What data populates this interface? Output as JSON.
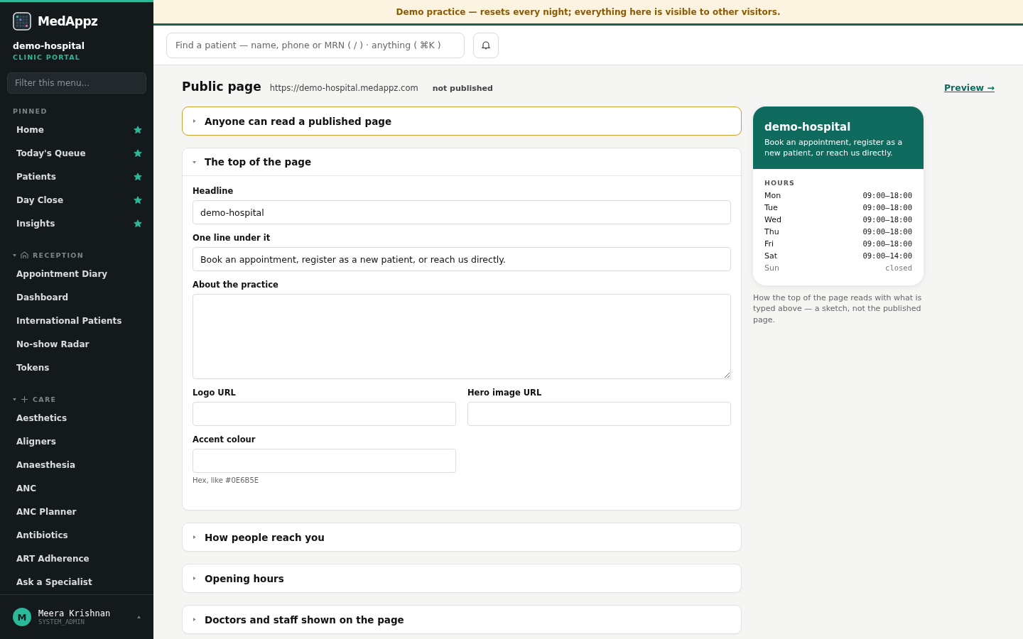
{
  "brand": {
    "name": "MedAppz",
    "org": "demo-hospital",
    "portal": "CLINIC PORTAL"
  },
  "sidebar": {
    "filter_placeholder": "Filter this menu...",
    "pinned": {
      "title": "PINNED",
      "items": [
        {
          "label": "Home",
          "starred": true
        },
        {
          "label": "Today's Queue",
          "starred": true
        },
        {
          "label": "Patients",
          "starred": true
        },
        {
          "label": "Day Close",
          "starred": true
        },
        {
          "label": "Insights",
          "starred": true
        }
      ]
    },
    "groups": [
      {
        "title": "RECEPTION",
        "expanded": true,
        "items": [
          "Appointment Diary",
          "Dashboard",
          "International Patients",
          "No-show Radar",
          "Tokens"
        ]
      },
      {
        "title": "CARE",
        "expanded": true,
        "items": [
          "Aesthetics",
          "Aligners",
          "Anaesthesia",
          "ANC",
          "ANC Planner",
          "Antibiotics",
          "ART Adherence",
          "Ask a Specialist"
        ]
      }
    ],
    "user": {
      "initial": "M",
      "name": "Meera Krishnan",
      "role": "SYSTEM_ADMIN"
    }
  },
  "banner": "Demo practice — resets every night; everything here is visible to other visitors.",
  "search": {
    "placeholder": "Find a patient — name, phone or MRN ( / ) · anything ( ⌘K )"
  },
  "page": {
    "title": "Public page",
    "url": "https://demo-hospital.medappz.com",
    "status": "not published",
    "preview_link": "Preview →"
  },
  "sections": [
    {
      "title": "Anyone can read a published page",
      "expanded": false,
      "selected": true
    },
    {
      "title": "The top of the page",
      "expanded": true,
      "selected": false,
      "fields": [
        {
          "kind": "text",
          "label": "Headline",
          "value": "demo-hospital"
        },
        {
          "kind": "text",
          "label": "One line under it",
          "value": "Book an appointment, register as a new patient, or reach us directly."
        },
        {
          "kind": "textarea",
          "label": "About the practice"
        },
        {
          "kind": "short",
          "label": "Logo URL"
        },
        {
          "kind": "short",
          "label": "Hero image URL"
        },
        {
          "kind": "short",
          "label": "Accent colour",
          "hint": "Hex, like #0E6B5E"
        }
      ]
    },
    {
      "title": "How people reach you",
      "expanded": false,
      "selected": false
    },
    {
      "title": "Opening hours",
      "expanded": false,
      "selected": false
    },
    {
      "title": "Doctors and staff shown on the page",
      "expanded": false,
      "selected": false
    }
  ],
  "preview": {
    "title": "demo-hospital",
    "subtitle": "Book an appointment, register as a new patient, or reach us directly.",
    "hours_title": "HOURS",
    "hours": [
      {
        "day": "Mon",
        "time": "09:00–18:00",
        "closed": false
      },
      {
        "day": "Tue",
        "time": "09:00–18:00",
        "closed": false
      },
      {
        "day": "Wed",
        "time": "09:00–18:00",
        "closed": false
      },
      {
        "day": "Thu",
        "time": "09:00–18:00",
        "closed": false
      },
      {
        "day": "Fri",
        "time": "09:00–18:00",
        "closed": false
      },
      {
        "day": "Sat",
        "time": "09:00–14:00",
        "closed": false
      },
      {
        "day": "Sun",
        "time": "closed",
        "closed": true
      }
    ],
    "caption": "How the top of the page reads with what is typed above — a sketch, not the published page."
  }
}
